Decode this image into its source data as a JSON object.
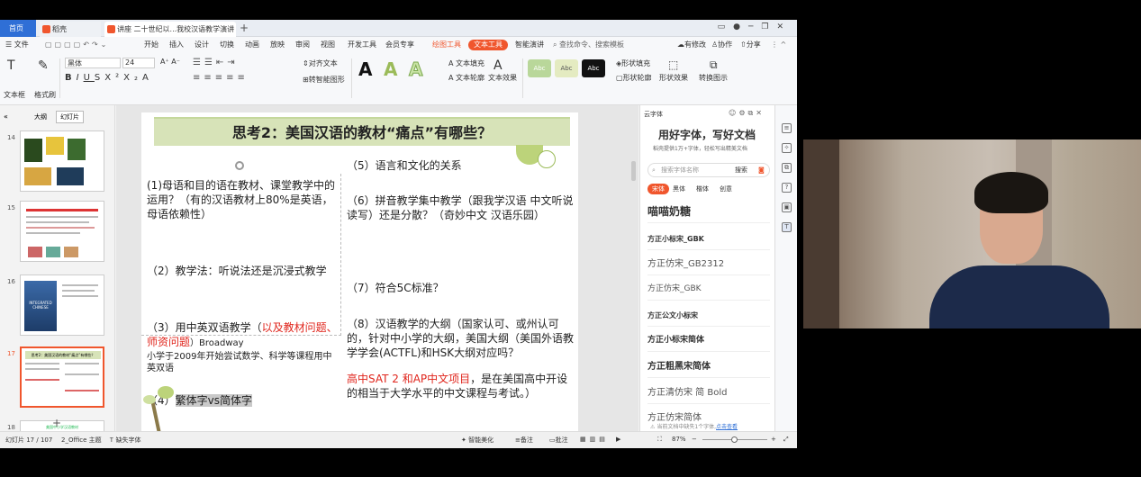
{
  "tabs": [
    {
      "label": "首页"
    },
    {
      "label": "稻壳"
    },
    {
      "label": "讲座 二十世纪以...我校汉语教学演讲"
    }
  ],
  "menu": [
    "文件",
    "开始",
    "插入",
    "设计",
    "切换",
    "动画",
    "放映",
    "审阅",
    "视图",
    "开发工具",
    "会员专享",
    "绘图工具",
    "文本工具",
    "智能演讲"
  ],
  "menu_search": "查找命令、搜索模板",
  "menu_right": [
    "有修改",
    "协作",
    "分享"
  ],
  "toolbar": {
    "textbox": "文本框",
    "format_painter": "格式刷",
    "font_name": "黑体",
    "font_size": "24",
    "align_text": "对齐文本",
    "convert_smartart": "转智能图形",
    "text_fill": "文本填充",
    "text_outline": "文本轮廓",
    "text_effect": "文本效果",
    "shape_fill": "形状填充",
    "shape_outline": "形状轮廓",
    "shape_effect": "形状效果",
    "convert_demo": "转换图示",
    "swatch_label": "Abc",
    "bigA": "A"
  },
  "left_panel": {
    "tabs": [
      "大纲",
      "幻灯片"
    ],
    "slides": [
      {
        "num": "14"
      },
      {
        "num": "15"
      },
      {
        "num": "16"
      },
      {
        "num": "17",
        "title": "思考2：美国汉语的教材“痛点”有哪些？"
      },
      {
        "num": "18",
        "title": "美国中小学汉语教材"
      }
    ],
    "thumb16_text": "INTEGRATED CHINESE"
  },
  "slide": {
    "title": "思考2：美国汉语的教材“痛点”有哪些？",
    "p1": "(1)母语和目的语在教材、课堂教学中的运用？（有的汉语教材上80%是英语，母语依赖性）",
    "p2": "（2）教学法：听说法还是沉浸式教学",
    "p3a": "（3）用中英双语教学（",
    "p3b": "以及教材问题、师资问题",
    "p3c": "）Broadway",
    "p3d": "小学于2009年开始尝试数学、科学等课程用中英双语",
    "p4a": "（4）",
    "p4b": "繁体字vs简体字",
    "p5": "（5）语言和文化的关系",
    "p6": "（6）拼音教学集中教学（跟我学汉语 中文听说读写）还是分散？（奇妙中文 汉语乐园）",
    "p7": "（7）符合5C标准？",
    "p8": "（8）汉语教学的大纲（国家认可、或州认可的，针对中小学的大纲，美国大纲（美国外语教学学会(ACTFL)和HSK大纲对应吗？",
    "p9a": "高中SAT 2 和AP中文项目",
    "p9b": "，是在美国高中开设的相当于大学水平的中文课程与考试。）"
  },
  "right_panel": {
    "header": "云字体",
    "slogan": "用好字体，写好文档",
    "sub": "稻壳提供1万+字体，轻松写出精美文档",
    "search_placeholder": "搜索字体名称",
    "search_btn": "搜索",
    "categories": [
      "宋体",
      "黑体",
      "楷体",
      "创意"
    ],
    "fonts": [
      "喵喵奶糖",
      "方正小标宋_GBK",
      "方正仿宋_GB2312",
      "方正仿宋_GBK",
      "方正公文小标宋",
      "方正小标宋简体",
      "方正粗黑宋简体",
      "方正清仿宋 简 Bold",
      "方正仿宋简体"
    ],
    "footer": "当前文档中缺失1个字体,",
    "footer_link": "点击查看"
  },
  "status": {
    "slide": "幻灯片 17 / 107",
    "theme": "2_Office 主题",
    "missing_font": "缺失字体",
    "beautify": "智能美化",
    "notes": "备注",
    "comments": "批注",
    "zoom": "87%"
  },
  "colors": {
    "accent_blue": "#2f6fd6",
    "accent_orange": "#f0562d",
    "title_green": "#d7e3b8",
    "red_text": "#e0251c"
  }
}
